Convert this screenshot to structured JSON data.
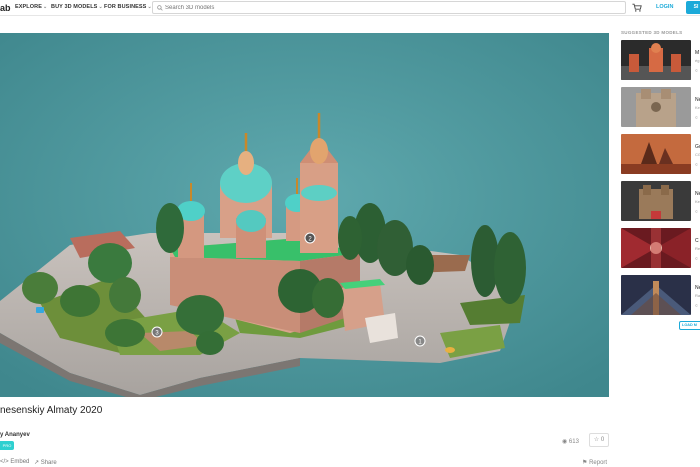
{
  "header": {
    "logo_text": "ab",
    "nav": [
      {
        "label": "EXPLORE"
      },
      {
        "label": "BUY 3D MODELS"
      },
      {
        "label": "FOR BUSINESS"
      }
    ],
    "search_placeholder": "Search 3D models",
    "login_label": "LOGIN",
    "signup_label": "SI"
  },
  "viewer": {
    "background_color": "#4f9aa0",
    "hotspots": [
      "2",
      "3",
      "1"
    ]
  },
  "sidebar": {
    "title": "SUGGESTED 3D MODELS",
    "items": [
      {
        "name": "M",
        "sub": "ég",
        "views": "©"
      },
      {
        "name": "Né",
        "sub": "Ke",
        "views": "©"
      },
      {
        "name": "Go",
        "sub": "CG",
        "views": "©"
      },
      {
        "name": "Né",
        "sub": "Ke",
        "views": "©"
      },
      {
        "name": "C",
        "sub": "Re",
        "views": "©"
      },
      {
        "name": "Ne",
        "sub": "Ra",
        "views": "©"
      }
    ],
    "load_more_label": "LOAD M"
  },
  "model": {
    "title": "nesenskiy Almaty 2020",
    "author": "y Ananyev",
    "badge": "PRO",
    "embed_label": "Embed",
    "share_label": "Share",
    "views": "613",
    "likes": "0",
    "report_label": "Report"
  },
  "colors": {
    "accent": "#1caad9",
    "badge": "#2fd0d0"
  }
}
